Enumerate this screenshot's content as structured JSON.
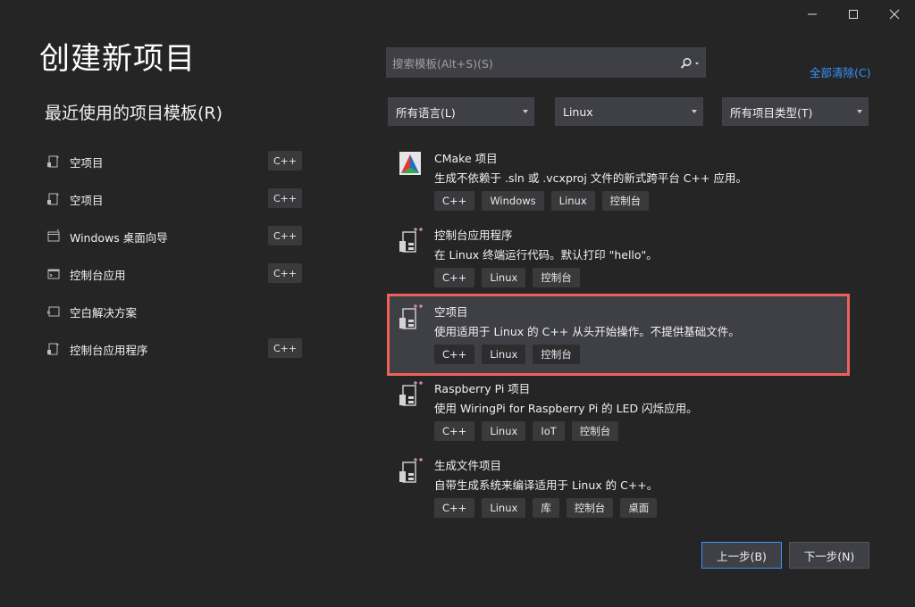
{
  "window": {
    "minimize": "—",
    "maximize": "□",
    "close": "✕"
  },
  "page": {
    "title": "创建新项目",
    "recent_heading": "最近使用的项目模板(R)"
  },
  "recent": [
    {
      "label": "空项目",
      "tag": "C++",
      "icon": "linux-project-icon"
    },
    {
      "label": "空项目",
      "tag": "C++",
      "icon": "windows-project-icon"
    },
    {
      "label": "Windows 桌面向导",
      "tag": "C++",
      "icon": "desktop-wizard-icon"
    },
    {
      "label": "控制台应用",
      "tag": "C++",
      "icon": "console-app-icon"
    },
    {
      "label": "空白解决方案",
      "tag": "",
      "icon": "blank-solution-icon"
    },
    {
      "label": "控制台应用程序",
      "tag": "C++",
      "icon": "console-app-icon"
    }
  ],
  "search": {
    "placeholder": "搜索模板(Alt+S)(S)",
    "value": ""
  },
  "clear_all": "全部清除(C)",
  "filters": {
    "language": "所有语言(L)",
    "platform": "Linux",
    "project_type": "所有项目类型(T)"
  },
  "templates": [
    {
      "name": "CMake 项目",
      "desc": "生成不依赖于 .sln 或 .vcxproj 文件的新式跨平台 C++ 应用。",
      "tags": [
        "C++",
        "Windows",
        "Linux",
        "控制台"
      ],
      "icon": "cmake-icon"
    },
    {
      "name": "控制台应用程序",
      "desc": "在 Linux 终端运行代码。默认打印 \"hello\"。",
      "tags": [
        "C++",
        "Linux",
        "控制台"
      ],
      "icon": "linux-cpp-project-icon"
    },
    {
      "name": "空项目",
      "desc": "使用适用于 Linux 的 C++ 从头开始操作。不提供基础文件。",
      "tags": [
        "C++",
        "Linux",
        "控制台"
      ],
      "icon": "linux-cpp-project-icon"
    },
    {
      "name": "Raspberry Pi 项目",
      "desc": "使用 WiringPi for Raspberry Pi 的 LED 闪烁应用。",
      "tags": [
        "C++",
        "Linux",
        "IoT",
        "控制台"
      ],
      "icon": "linux-cpp-project-icon"
    },
    {
      "name": "生成文件项目",
      "desc": "自带生成系统来编译适用于 Linux 的 C++。",
      "tags": [
        "C++",
        "Linux",
        "库",
        "控制台",
        "桌面"
      ],
      "icon": "linux-cpp-project-icon"
    }
  ],
  "buttons": {
    "back": "上一步(B)",
    "next": "下一步(N)"
  },
  "colors": {
    "background": "#252526",
    "accent": "#3794ff",
    "highlight_border": "#f0605a"
  }
}
